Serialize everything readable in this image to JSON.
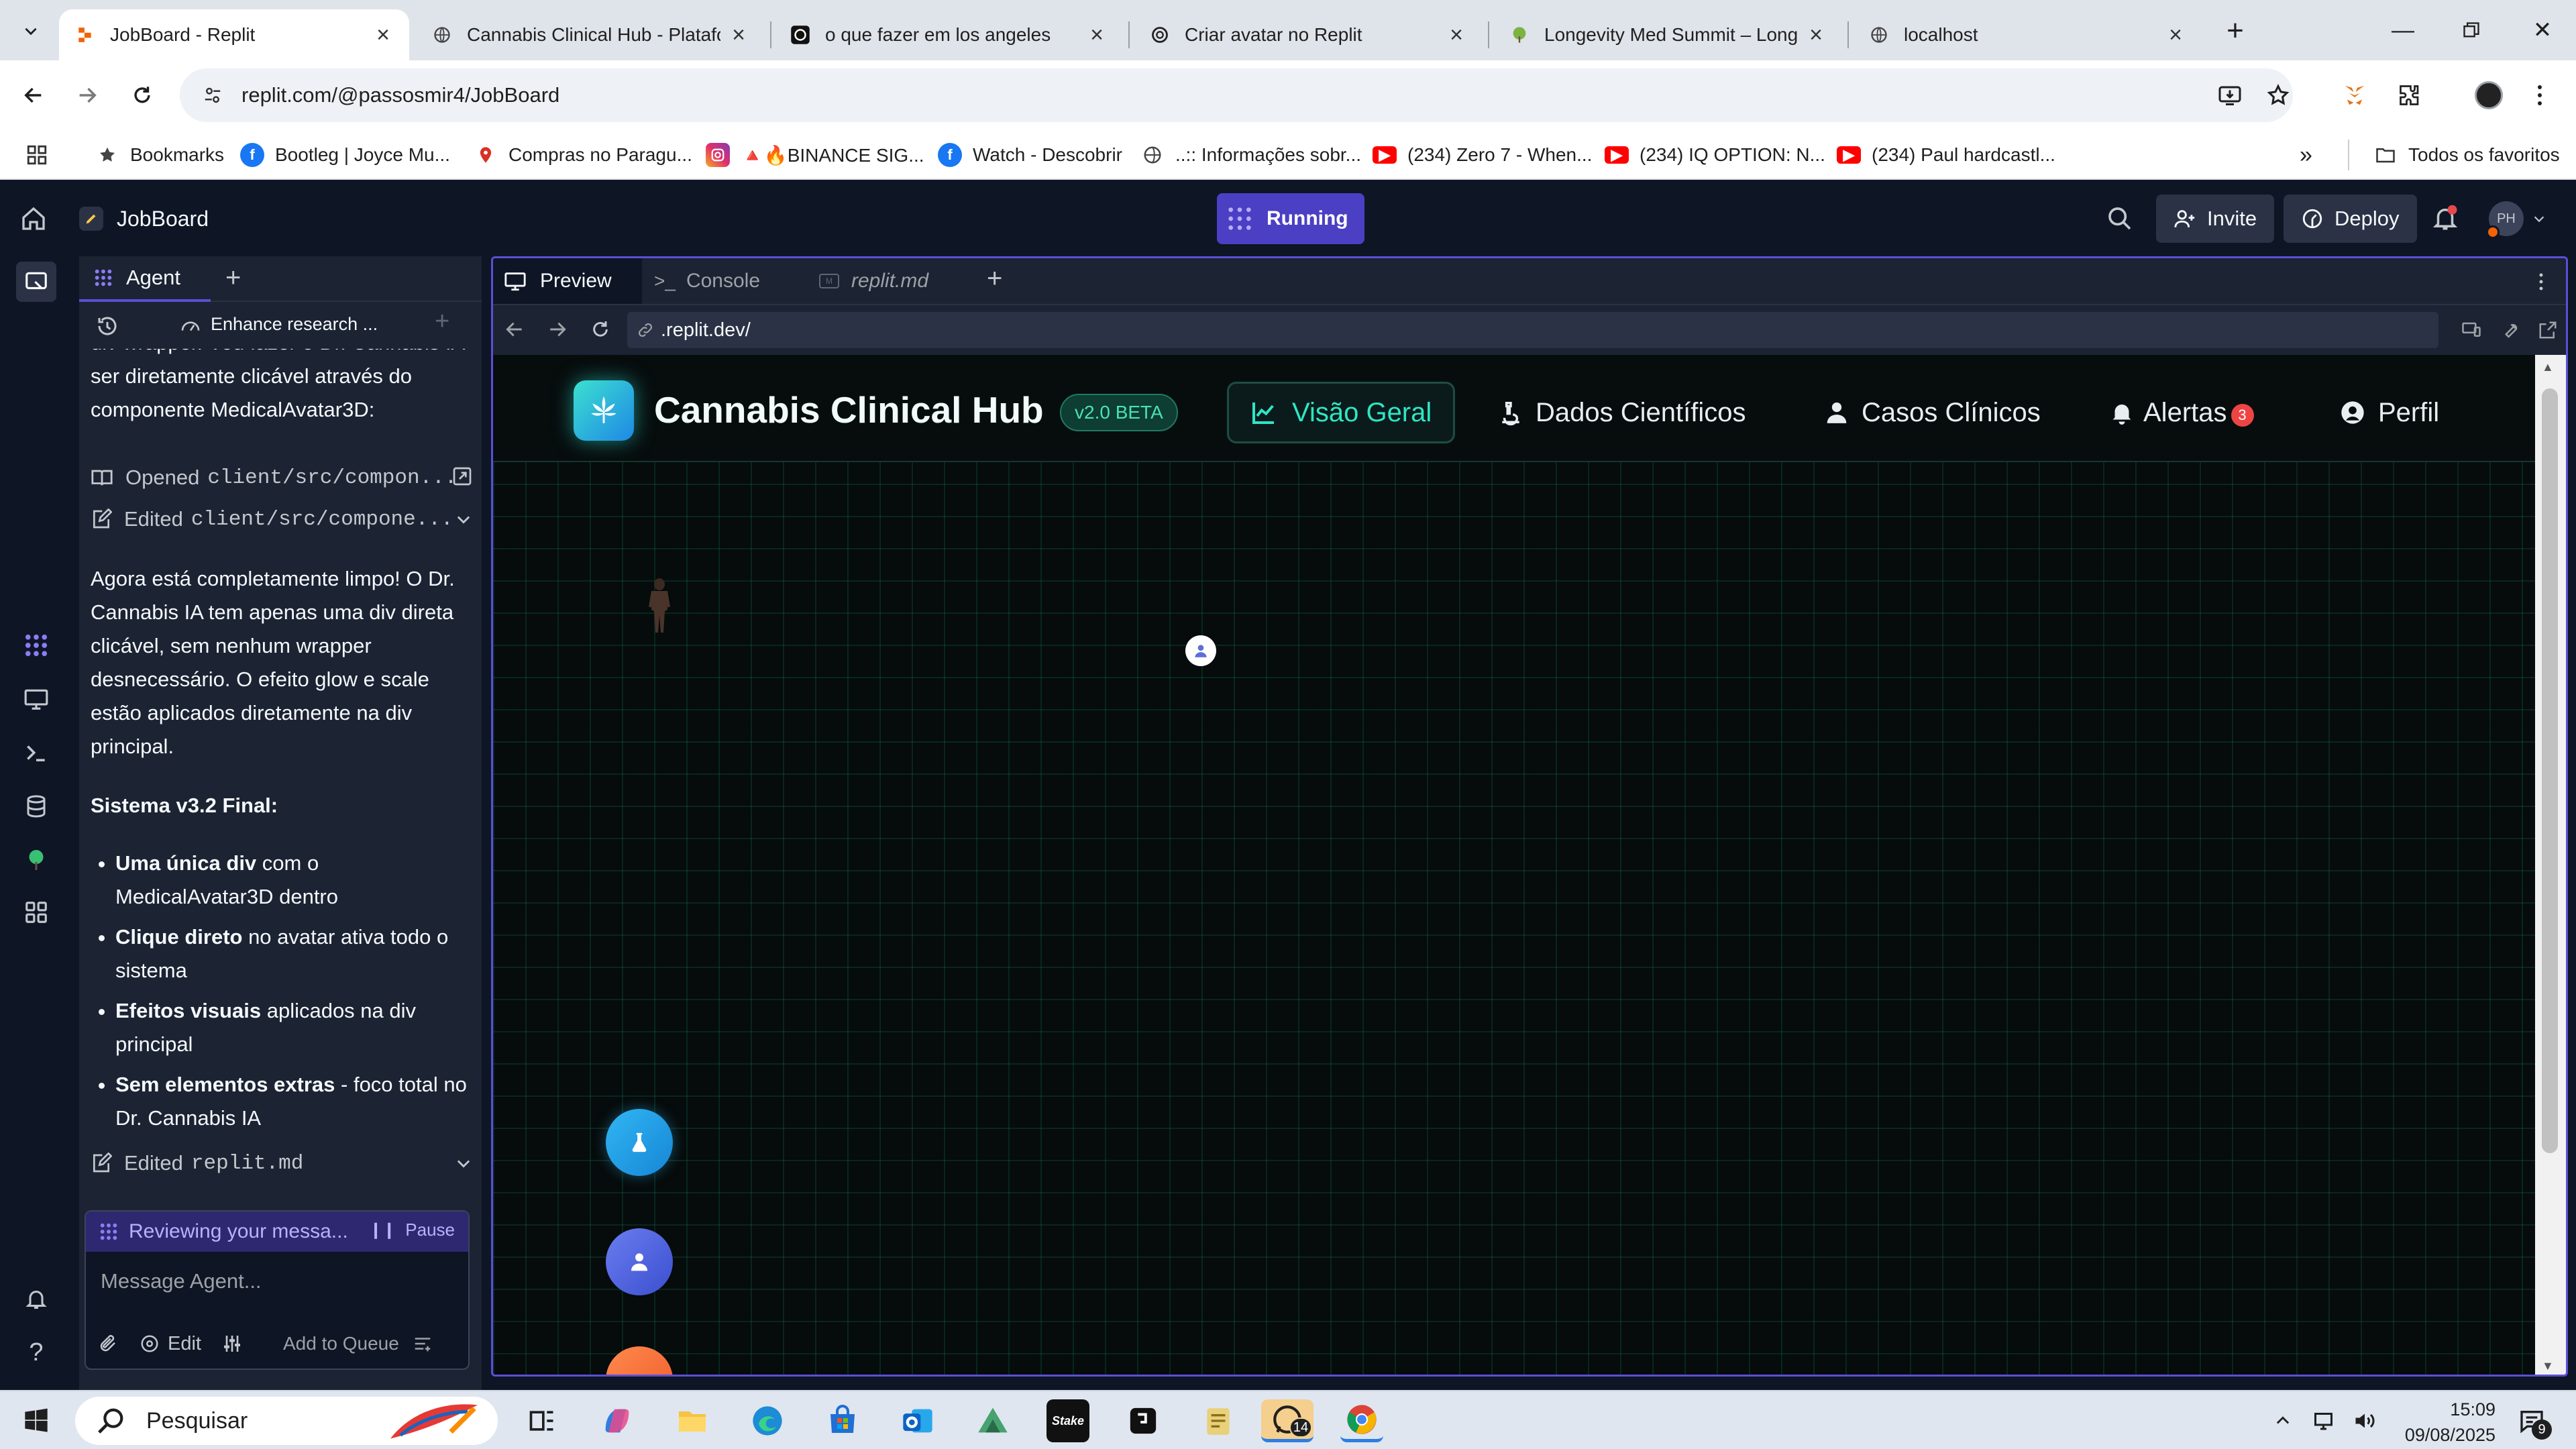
{
  "browser": {
    "tabs": [
      {
        "title": "JobBoard - Replit",
        "active": true
      },
      {
        "title": "Cannabis Clinical Hub - Platafor",
        "active": false
      },
      {
        "title": "o que fazer em los angeles",
        "active": false
      },
      {
        "title": "Criar avatar no Replit",
        "active": false
      },
      {
        "title": "Longevity Med Summit – Longe",
        "active": false
      },
      {
        "title": "localhost",
        "active": false
      }
    ],
    "url": "replit.com/@passosmir4/JobBoard",
    "bookmarks": [
      {
        "label": "Bookmarks",
        "icon": "star-icon"
      },
      {
        "label": "Bootleg | Joyce Mu...",
        "icon": "facebook-icon"
      },
      {
        "label": "Compras no Paragu...",
        "icon": "map-pin-icon"
      },
      {
        "label": "🔺🔥BINANCE SIG...",
        "icon": "instagram-icon"
      },
      {
        "label": "Watch - Descobrir",
        "icon": "facebook-icon"
      },
      {
        "label": "..:: Informações sobr...",
        "icon": "globe-icon"
      },
      {
        "label": "(234) Zero 7 - When...",
        "icon": "youtube-icon"
      },
      {
        "label": "(234) IQ OPTION: N...",
        "icon": "youtube-icon"
      },
      {
        "label": "(234) Paul hardcastl...",
        "icon": "youtube-icon"
      }
    ],
    "all_bookmarks_label": "Todos os favoritos",
    "colors": {
      "tab_strip": "#dfe3ea",
      "youtube": "#ff0000",
      "facebook": "#1877f2"
    }
  },
  "replit": {
    "project_name": "JobBoard",
    "status_label": "Running",
    "invite_label": "Invite",
    "deploy_label": "Deploy",
    "avatar_initials": "PH",
    "colors": {
      "bg": "#0e1525",
      "panel": "#1c2333",
      "accent": "#5b4fd6",
      "running": "#4b3fc4"
    }
  },
  "agent": {
    "tab_label": "Agent",
    "history_title": "Enhance research ...",
    "partial_line": "div wrapper. Vou fazer o Dr. Cannabis IA ser diretamente clicável através do componente MedicalAvatar3D:",
    "actions": [
      {
        "verb": "Opened",
        "path": "client/src/compon..."
      },
      {
        "verb": "Edited",
        "path": "client/src/compone..."
      }
    ],
    "paragraph": "Agora está completamente limpo! O Dr. Cannabis IA tem apenas uma div direta clicável, sem nenhum wrapper desnecessário. O efeito glow e scale estão aplicados diretamente na div principal.",
    "heading": "Sistema v3.2 Final:",
    "bullets": [
      {
        "bold": "Uma única div",
        "rest": " com o MedicalAvatar3D dentro"
      },
      {
        "bold": "Clique direto",
        "rest": " no avatar ativa todo o sistema"
      },
      {
        "bold": "Efeitos visuais",
        "rest": " aplicados na div principal"
      },
      {
        "bold": "Sem elementos extras",
        "rest": " - foco total no Dr. Cannabis IA"
      }
    ],
    "last_action": {
      "verb": "Edited",
      "path": "replit.md"
    },
    "status_text": "Reviewing your messa...",
    "pause_label": "Pause",
    "input_placeholder": "Message Agent...",
    "edit_label": "Edit",
    "queue_label": "Add to Queue"
  },
  "preview": {
    "tabs": [
      "Preview",
      "Console",
      "replit.md"
    ],
    "url": ".replit.dev/"
  },
  "app": {
    "title": "Cannabis Clinical Hub",
    "version_badge": "v2.0 BETA",
    "nav": [
      {
        "label": "Visão Geral",
        "icon": "chart-line-icon",
        "active": true
      },
      {
        "label": "Dados Científicos",
        "icon": "microscope-icon",
        "active": false
      },
      {
        "label": "Casos Clínicos",
        "icon": "user-doctor-icon",
        "active": false
      },
      {
        "label": "Alertas",
        "icon": "bell-icon",
        "active": false,
        "badge": "3"
      },
      {
        "label": "Perfil",
        "icon": "user-circle-icon",
        "active": false
      }
    ],
    "colors": {
      "bg": "#060b0b",
      "grid": "#0f6e50",
      "accent": "#17c3a0",
      "flask_button": "#1e9be0",
      "user_button": "#4a60d8",
      "orange_button": "#f26d3d"
    }
  },
  "taskbar": {
    "search_label": "Pesquisar",
    "time": "15:09",
    "date": "09/08/2025",
    "whatsapp_badge": "14",
    "notification_badge": "9"
  }
}
